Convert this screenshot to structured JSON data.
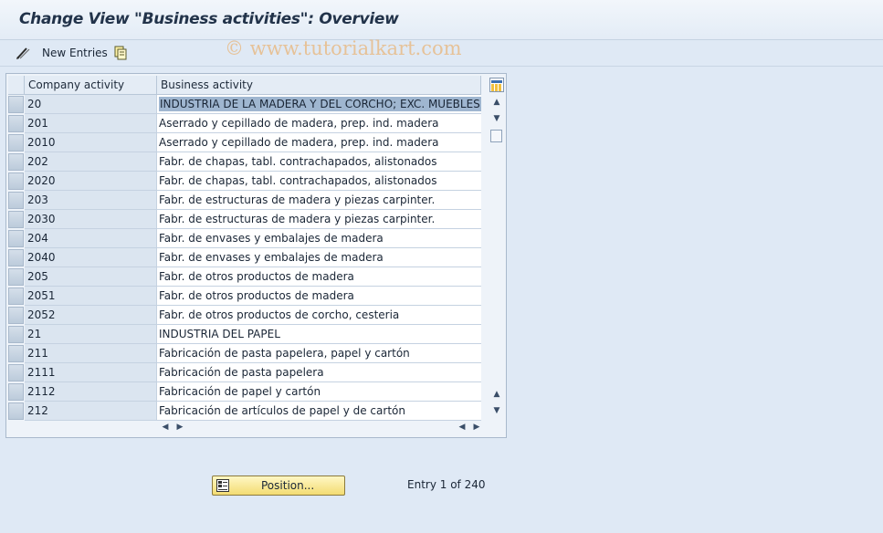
{
  "window": {
    "title": "Change View \"Business activities\": Overview"
  },
  "toolbar": {
    "new_entries_label": "New Entries",
    "icons": [
      "edit-glasses-icon",
      "copy-icon"
    ]
  },
  "watermark": "© www.tutorialkart.com",
  "table": {
    "columns": [
      "Company activity",
      "Business activity"
    ],
    "rows": [
      {
        "code": "20",
        "desc": "INDUSTRIA DE LA MADERA Y DEL CORCHO; EXC. MUEBLES",
        "selected": true
      },
      {
        "code": "201",
        "desc": "Aserrado y cepillado de madera, prep. ind. madera"
      },
      {
        "code": "2010",
        "desc": "Aserrado y cepillado de madera, prep. ind. madera"
      },
      {
        "code": "202",
        "desc": "Fabr. de chapas, tabl. contrachapados, alistonados"
      },
      {
        "code": "2020",
        "desc": "Fabr. de chapas, tabl. contrachapados, alistonados"
      },
      {
        "code": "203",
        "desc": "Fabr. de estructuras de madera y piezas carpinter."
      },
      {
        "code": "2030",
        "desc": "Fabr. de estructuras de madera y piezas carpinter."
      },
      {
        "code": "204",
        "desc": "Fabr. de envases y embalajes de madera"
      },
      {
        "code": "2040",
        "desc": "Fabr. de envases y embalajes de madera"
      },
      {
        "code": "205",
        "desc": "Fabr. de otros productos de madera"
      },
      {
        "code": "2051",
        "desc": "Fabr. de otros productos de madera"
      },
      {
        "code": "2052",
        "desc": "Fabr. de otros productos de corcho, cesteria"
      },
      {
        "code": "21",
        "desc": "INDUSTRIA DEL PAPEL"
      },
      {
        "code": "211",
        "desc": "Fabricación de pasta papelera, papel y cartón"
      },
      {
        "code": "2111",
        "desc": "Fabricación de pasta papelera"
      },
      {
        "code": "2112",
        "desc": "Fabricación de papel y cartón"
      },
      {
        "code": "212",
        "desc": "Fabricación de artículos de papel y de cartón"
      }
    ]
  },
  "footer": {
    "position_button_label": "Position...",
    "entry_text": "Entry 1 of 240"
  },
  "colors": {
    "background": "#dfe9f5",
    "selection": "#9fb6d0",
    "button": "#f3dc72"
  }
}
